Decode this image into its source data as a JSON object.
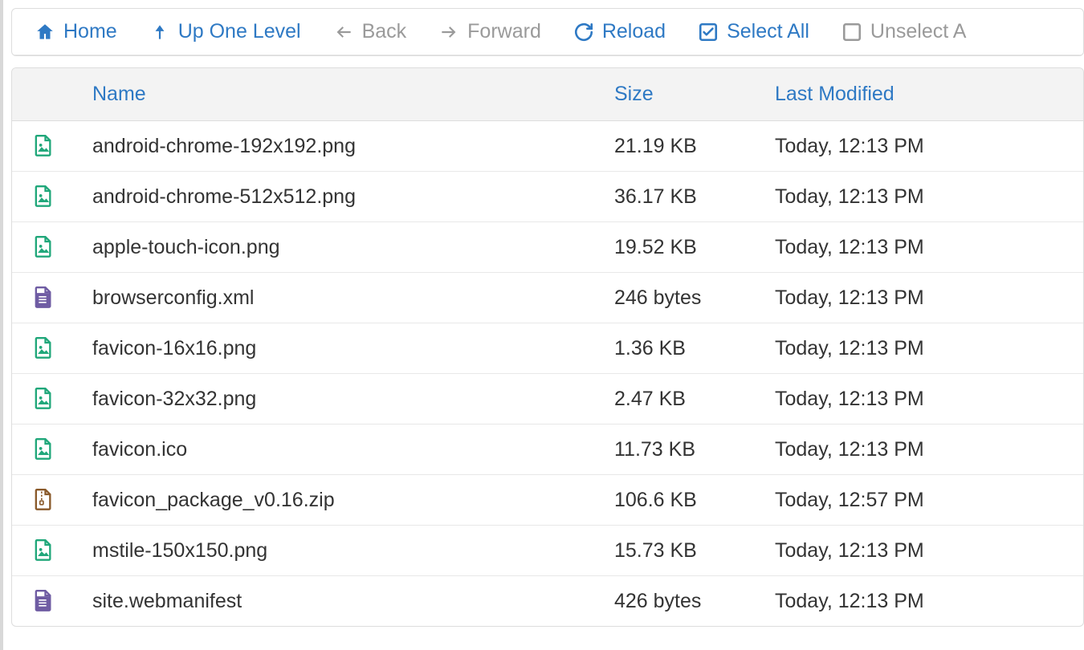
{
  "toolbar": {
    "home": {
      "label": "Home",
      "enabled": true,
      "icon": "home-icon"
    },
    "up": {
      "label": "Up One Level",
      "enabled": true,
      "icon": "level-up-icon"
    },
    "back": {
      "label": "Back",
      "enabled": false,
      "icon": "arrow-left-icon"
    },
    "forward": {
      "label": "Forward",
      "enabled": false,
      "icon": "arrow-right-icon"
    },
    "reload": {
      "label": "Reload",
      "enabled": true,
      "icon": "reload-icon"
    },
    "select_all": {
      "label": "Select All",
      "enabled": true,
      "icon": "check-square-icon"
    },
    "unselect_all": {
      "label": "Unselect A",
      "enabled": false,
      "icon": "square-icon"
    }
  },
  "columns": {
    "name": "Name",
    "size": "Size",
    "modified": "Last Modified"
  },
  "icons": {
    "image": {
      "color": "#20a77a",
      "kind": "image"
    },
    "document": {
      "color": "#6f5ca3",
      "kind": "document"
    },
    "archive": {
      "color": "#8a5a2b",
      "kind": "archive"
    }
  },
  "files": [
    {
      "name": "android-chrome-192x192.png",
      "size": "21.19 KB",
      "modified": "Today, 12:13 PM",
      "icon": "image"
    },
    {
      "name": "android-chrome-512x512.png",
      "size": "36.17 KB",
      "modified": "Today, 12:13 PM",
      "icon": "image"
    },
    {
      "name": "apple-touch-icon.png",
      "size": "19.52 KB",
      "modified": "Today, 12:13 PM",
      "icon": "image"
    },
    {
      "name": "browserconfig.xml",
      "size": "246 bytes",
      "modified": "Today, 12:13 PM",
      "icon": "document"
    },
    {
      "name": "favicon-16x16.png",
      "size": "1.36 KB",
      "modified": "Today, 12:13 PM",
      "icon": "image"
    },
    {
      "name": "favicon-32x32.png",
      "size": "2.47 KB",
      "modified": "Today, 12:13 PM",
      "icon": "image"
    },
    {
      "name": "favicon.ico",
      "size": "11.73 KB",
      "modified": "Today, 12:13 PM",
      "icon": "image"
    },
    {
      "name": "favicon_package_v0.16.zip",
      "size": "106.6 KB",
      "modified": "Today, 12:57 PM",
      "icon": "archive"
    },
    {
      "name": "mstile-150x150.png",
      "size": "15.73 KB",
      "modified": "Today, 12:13 PM",
      "icon": "image"
    },
    {
      "name": "site.webmanifest",
      "size": "426 bytes",
      "modified": "Today, 12:13 PM",
      "icon": "document"
    }
  ]
}
